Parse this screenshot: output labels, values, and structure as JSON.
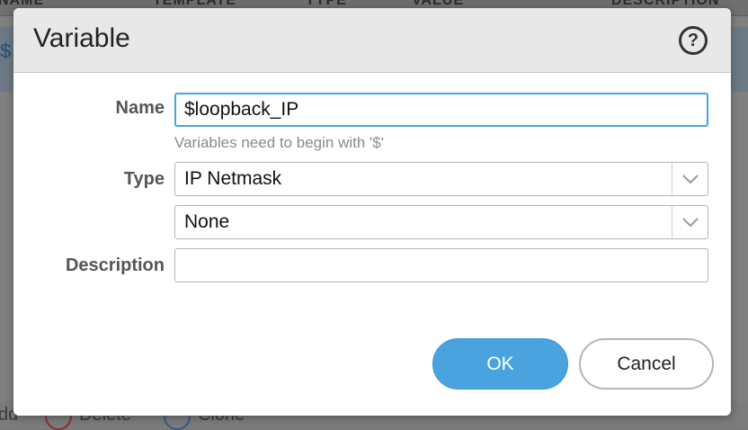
{
  "background": {
    "columns": [
      "NAME",
      "TEMPLATE",
      "TYPE",
      "VALUE",
      "DESCRIPTION"
    ],
    "row_text": "$",
    "footer": {
      "add_label": "dd",
      "delete_label": "Delete",
      "clone_label": "Clone"
    }
  },
  "dialog": {
    "title": "Variable",
    "help_icon": "question-circle-icon",
    "name": {
      "label": "Name",
      "value": "$loopback_IP",
      "hint": "Variables need to begin with '$'"
    },
    "type": {
      "label": "Type",
      "value": "IP Netmask",
      "sub_value": "None"
    },
    "description": {
      "label": "Description",
      "value": ""
    },
    "buttons": {
      "ok": "OK",
      "cancel": "Cancel"
    },
    "colors": {
      "accent": "#4aa3df",
      "header_bg": "#e8e8e8"
    }
  }
}
